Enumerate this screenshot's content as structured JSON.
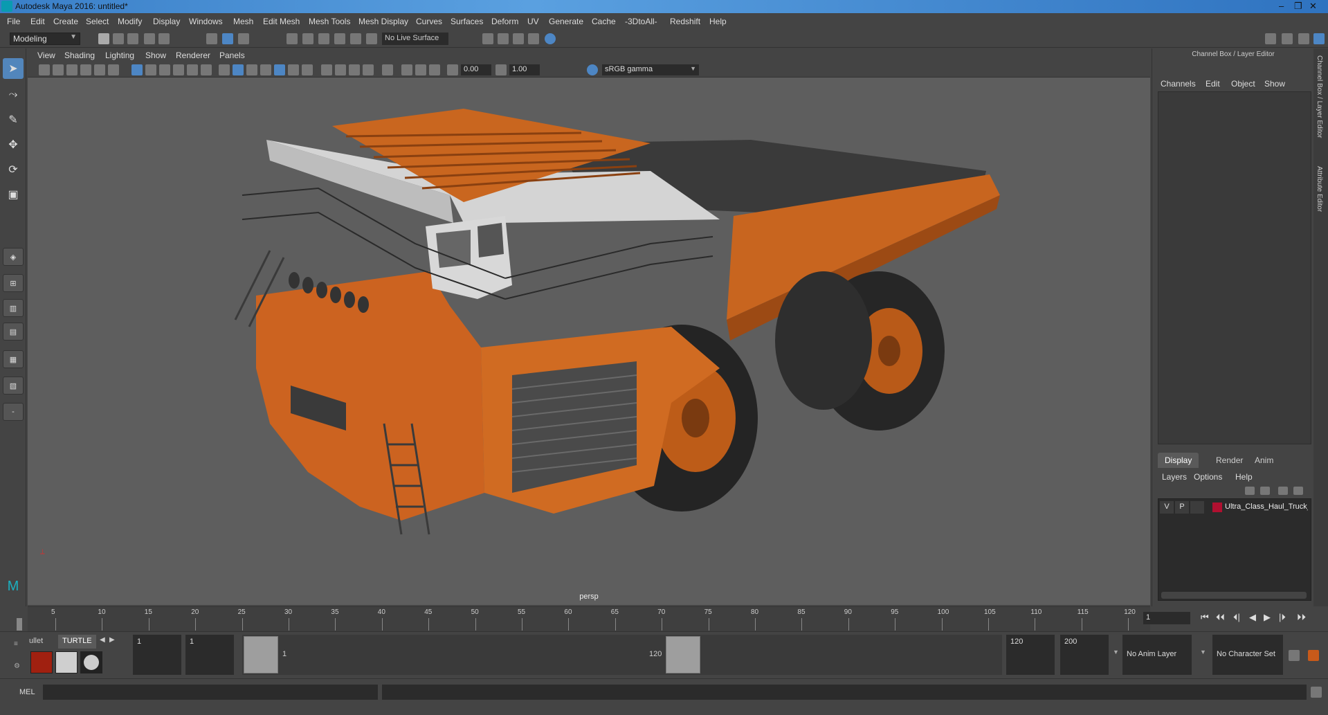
{
  "window": {
    "title": "Autodesk Maya 2016: untitled*",
    "controls": [
      "–",
      "❐",
      "✕"
    ]
  },
  "menubar": [
    "File",
    "Edit",
    "Create",
    "Select",
    "Modify",
    "Display",
    "Windows",
    "Mesh",
    "Edit Mesh",
    "Mesh Tools",
    "Mesh Display",
    "Curves",
    "Surfaces",
    "Deform",
    "UV",
    "Generate",
    "Cache",
    "-3DtoAll-",
    "Redshift",
    "Help"
  ],
  "statusline": {
    "mode": "Modeling",
    "live_surface": "No Live Surface"
  },
  "viewport": {
    "menus": [
      "View",
      "Shading",
      "Lighting",
      "Show",
      "Renderer",
      "Panels"
    ],
    "exposure": "0.00",
    "gamma": "1.00",
    "color_space": "sRGB gamma",
    "camera_label": "persp",
    "scene_colors": {
      "truck_orange": "#d2691e",
      "bed_white": "#c9c9c9",
      "tire": "#2a2a2a",
      "background": "#5e5e5e"
    }
  },
  "rightpanel": {
    "title": "Channel Box / Layer Editor",
    "channel_menu": [
      "Channels",
      "Edit",
      "Object",
      "Show"
    ],
    "tabs": [
      "Display",
      "Render",
      "Anim"
    ],
    "active_tab": "Display",
    "layer_menu": [
      "Layers",
      "Options",
      "Help"
    ],
    "layers": [
      {
        "v": "V",
        "p": "P",
        "color": "#b01030",
        "name": "Ultra_Class_Haul_Truck_D"
      }
    ],
    "side_tabs": [
      "Channel Box / Layer Editor",
      "Attribute Editor"
    ]
  },
  "timeslider": {
    "ticks": [
      "5",
      "10",
      "15",
      "20",
      "25",
      "30",
      "35",
      "40",
      "45",
      "50",
      "55",
      "60",
      "65",
      "70",
      "75",
      "80",
      "85",
      "90",
      "95",
      "100",
      "105",
      "110",
      "115",
      "120"
    ],
    "start_label": "1",
    "end_label": "120",
    "current_frame": "1",
    "playback_buttons": [
      "⏮",
      "⏴⏴",
      "⏴|",
      "◀",
      "▶",
      "|⏵",
      "⏵⏵"
    ]
  },
  "range": {
    "shelf_tabs": [
      "ullet",
      "TURTLE"
    ],
    "start_time": "1",
    "playback_start": "1",
    "range_start_label": "1",
    "range_end_label": "120",
    "playback_end": "120",
    "end_time": "200",
    "anim_layer": "No Anim Layer",
    "character_set": "No Character Set"
  },
  "mel": {
    "label": "MEL"
  }
}
